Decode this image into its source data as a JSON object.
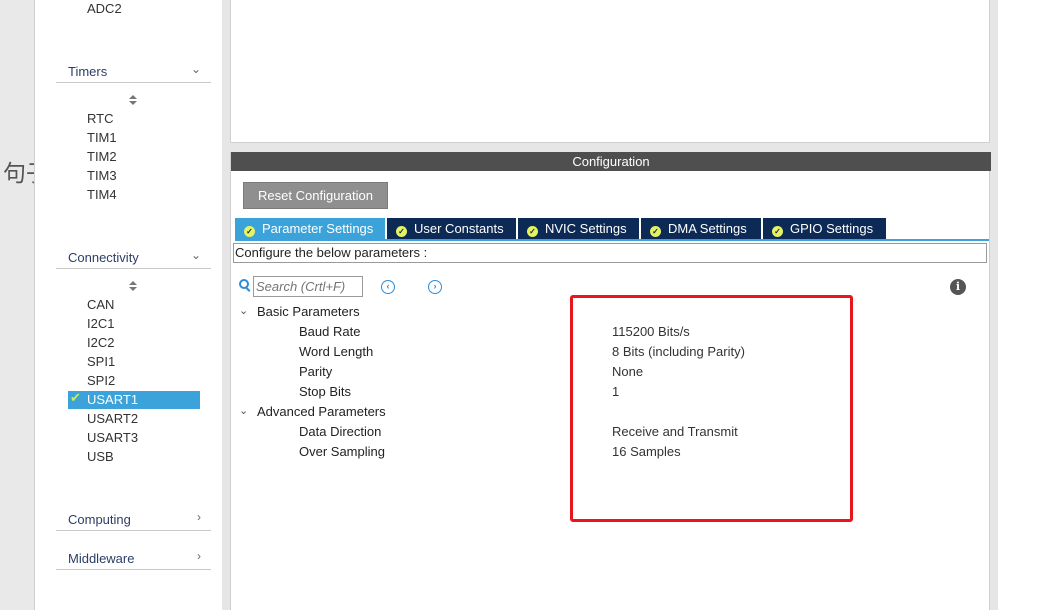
{
  "backdrop": {
    "text": "句子"
  },
  "sidebar": {
    "top_item": "ADC2",
    "timers": {
      "label": "Timers",
      "items": [
        "RTC",
        "TIM1",
        "TIM2",
        "TIM3",
        "TIM4"
      ]
    },
    "connectivity": {
      "label": "Connectivity",
      "items": [
        "CAN",
        "I2C1",
        "I2C2",
        "SPI1",
        "SPI2",
        "USART1",
        "USART2",
        "USART3",
        "USB"
      ],
      "selected": "USART1"
    },
    "computing": {
      "label": "Computing"
    },
    "middleware": {
      "label": "Middleware"
    }
  },
  "config": {
    "title": "Configuration",
    "reset_label": "Reset Configuration",
    "tabs": [
      {
        "label": "Parameter Settings",
        "active": true
      },
      {
        "label": "User Constants",
        "active": false
      },
      {
        "label": "NVIC Settings",
        "active": false
      },
      {
        "label": "DMA Settings",
        "active": false
      },
      {
        "label": "GPIO Settings",
        "active": false
      }
    ],
    "hint": "Configure the below parameters :",
    "search": {
      "placeholder": "Search (Crtl+F)"
    },
    "groups": [
      {
        "label": "Basic Parameters",
        "params": [
          {
            "name": "Baud Rate",
            "value": "115200 Bits/s"
          },
          {
            "name": "Word Length",
            "value": "8 Bits (including Parity)"
          },
          {
            "name": "Parity",
            "value": "None"
          },
          {
            "name": "Stop Bits",
            "value": "1"
          }
        ]
      },
      {
        "label": "Advanced Parameters",
        "params": [
          {
            "name": "Data Direction",
            "value": "Receive and Transmit"
          },
          {
            "name": "Over Sampling",
            "value": "16 Samples"
          }
        ]
      }
    ]
  },
  "colors": {
    "accent": "#3ba3d9",
    "tab_dark": "#0c2a55",
    "highlight": "#e8161c"
  }
}
